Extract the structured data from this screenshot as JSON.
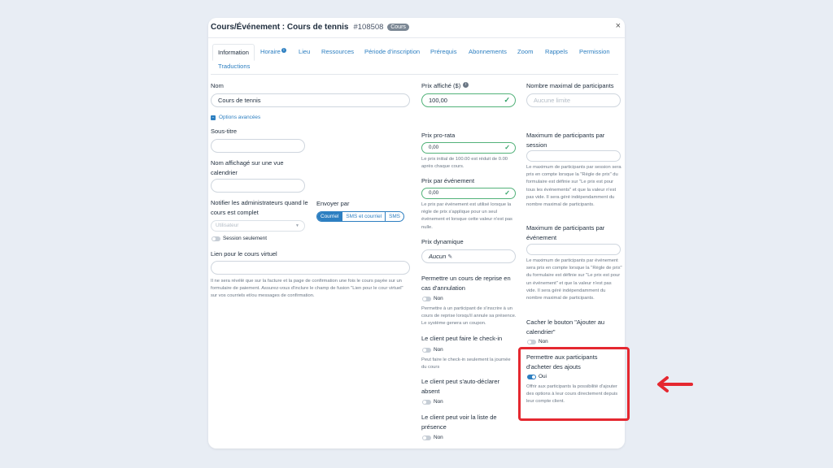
{
  "header": {
    "title": "Cours/Événement : Cours de tennis",
    "number": "#108508",
    "badge": "Cours",
    "close": "×"
  },
  "tabs": [
    "Information",
    "Horaire",
    "Lieu",
    "Ressources",
    "Période d'inscription",
    "Prérequis",
    "Abonnements",
    "Zoom",
    "Rappels",
    "Permission",
    "Traductions"
  ],
  "col1": {
    "nom_label": "Nom",
    "nom_value": "Cours de tennis",
    "options_avancees": "Options avancées",
    "sous_titre_label": "Sous-titre",
    "nom_affichage_label": "Nom affichagé sur une vue calendrier",
    "notifier_label": "Notifier les administrateurs quand le cours est complet",
    "notifier_placeholder": "Utilisateur",
    "session_seulement": "Session seulement",
    "envoyer_par_label": "Envoyer par",
    "envoyer_options": [
      "Courriel",
      "SMS et courriel",
      "SMS"
    ],
    "lien_label": "Lien pour le cours virtuel",
    "lien_hint": "Il ne sera révélé que sur la facture et la page de confirmation une fois le cours payée sur un formulaire de paiement. Assurez-vous d'inclure le champ de fusion \"Lien pour le cour virtuel\" sur vos courriels et/ou messages de confirmation."
  },
  "col2": {
    "prix_label": "Prix affiché ($)",
    "prix_value": "100,00",
    "prorata_label": "Prix pro-rata",
    "prorata_value": "0,00",
    "prorata_hint": "Le prix initial de 100.00 est réduit de 0.00 après chaque cours.",
    "par_evenement_label": "Prix par événement",
    "par_evenement_value": "0,00",
    "par_evenement_hint": "Le prix par événement est utilisé lorsque la règle de prix s'applique pour un seul événement et lorsque cette valeur n'est pas nulle.",
    "dynamique_label": "Prix dynamique",
    "dynamique_value": "Aucun",
    "reprise_label": "Permettre un cours de reprise en cas d'annulation",
    "reprise_value": "Non",
    "reprise_hint": "Permettre à un participant de s'inscrire à un cours de reprise lorsqu'il annule sa présence. Le système genera un coupon.",
    "checkin_label": "Le client peut faire le check-in",
    "checkin_value": "Non",
    "checkin_hint": "Peut faire le check-in seulement la journée du cours",
    "absent_label": "Le client peut s'auto-déclarer absent",
    "absent_value": "Non",
    "liste_label": "Le client peut voir la liste de présence",
    "liste_value": "Non"
  },
  "col3": {
    "max_label": "Nombre maximal de participants",
    "max_placeholder": "Aucune limite",
    "max_session_label": "Maximum de participants par session",
    "max_session_hint": "Le maximum de participants par session sera pris en compte lorsque la \"Règle de prix\" du formulaire est définie sur \"Le prix est pour tous les événements\" et que la valeur n'est pas vide. Il sera géré indépendamment du nombre maximal de participants.",
    "max_evenement_label": "Maximum de participants par événement",
    "max_evenement_hint": "Le maximum de participants par événement sera pris en compte lorsque la \"Règle de prix\" du formulaire est définie sur \"Le prix est pour un événement\" et que la valeur n'est pas vide. Il sera géré indépendamment du nombre maximal de participants.",
    "cacher_label": "Cacher le bouton \"Ajouter au calendrier\"",
    "cacher_value": "Non",
    "ajouts_label": "Permettre aux participants d'acheter des ajouts",
    "ajouts_value": "Oui",
    "ajouts_hint": "Offrir aux participants la possibilité d'ajouter des options à leur cours directement depuis leur compte client."
  },
  "colors": {
    "accent": "#2d7fc1",
    "highlight": "#e52830",
    "valid": "#53b27a"
  }
}
